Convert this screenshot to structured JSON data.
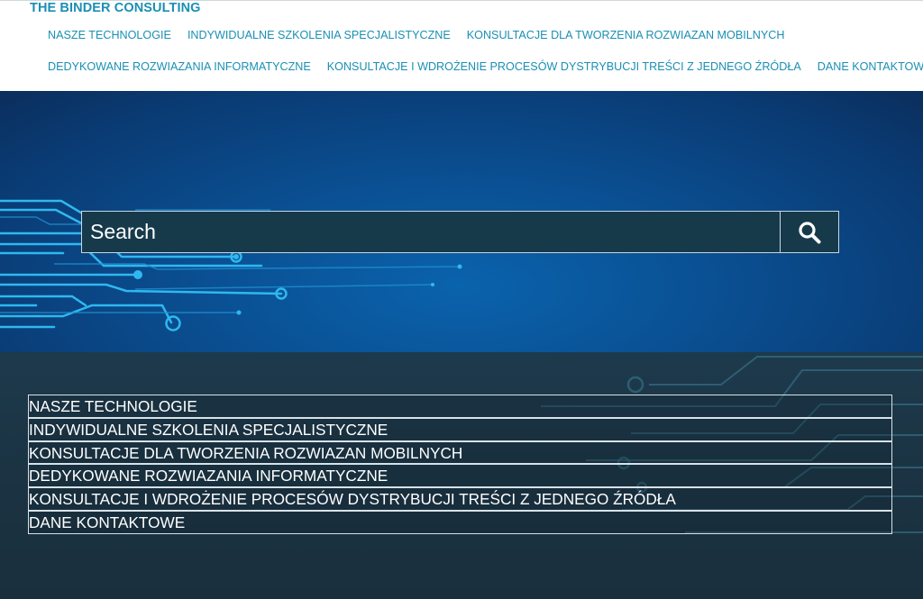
{
  "brand": {
    "name": "THE BINDER CONSULTING"
  },
  "nav": {
    "row1": [
      "NASZE TECHNOLOGIE",
      "INDYWIDUALNE SZKOLENIA SPECJALISTYCZNE",
      "KONSULTACJE DLA TWORZENIA ROZWIAZAN MOBILNYCH"
    ],
    "row2": [
      "DEDYKOWANE ROZWIAZANIA INFORMATYCZNE",
      "KONSULTACJE I WDROŻENIE PROCESÓW DYSTRYBUCJI TREŚCI Z JEDNEGO ŹRÓDŁA",
      "DANE KONTAKTOWE"
    ]
  },
  "search": {
    "placeholder": "Search",
    "button_icon": "search-icon"
  },
  "menu": {
    "items": [
      "NASZE TECHNOLOGIE",
      "INDYWIDUALNE SZKOLENIA SPECJALISTYCZNE",
      "KONSULTACJE DLA TWORZENIA ROZWIAZAN MOBILNYCH",
      "DEDYKOWANE ROZWIAZANIA INFORMATYCZNE",
      "KONSULTACJE I WDROŻENIE PROCESÓW DYSTRYBUCJI TREŚCI Z JEDNEGO ŹRÓDŁA",
      "DANE KONTAKTOWE"
    ]
  },
  "colors": {
    "brand": "#1a8fb4",
    "accent": "#29b6e8",
    "hero_bg": "#0a4f92",
    "lower_bg": "#1b3343"
  }
}
